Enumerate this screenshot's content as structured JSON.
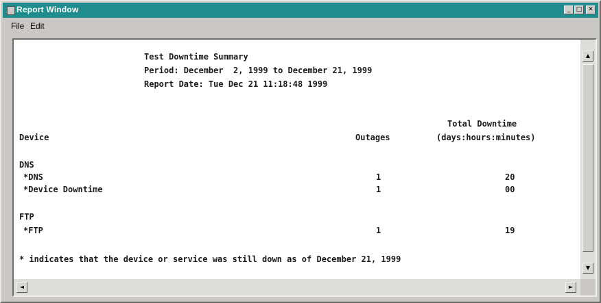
{
  "window": {
    "title": "Report Window",
    "minimize_glyph": "_",
    "maximize_glyph": "□",
    "close_glyph": "✕"
  },
  "menu": {
    "items": [
      {
        "label": "File"
      },
      {
        "label": "Edit"
      }
    ]
  },
  "report": {
    "title": "Test Downtime Summary",
    "period": "Period: December  2, 1999 to December 21, 1999",
    "report_date": "Report Date: Tue Dec 21 11:18:48 1999",
    "columns": {
      "device": "Device",
      "outages": "Outages",
      "total_downtime": "Total Downtime",
      "downtime_units": "(days:hours:minutes)"
    },
    "groups": [
      {
        "name": "DNS",
        "rows": [
          {
            "device": "*DNS",
            "outages": "1",
            "downtime": "20"
          },
          {
            "device": "*Device Downtime",
            "outages": "1",
            "downtime": "00"
          }
        ]
      },
      {
        "name": "FTP",
        "rows": [
          {
            "device": "*FTP",
            "outages": "1",
            "downtime": "19"
          }
        ]
      }
    ],
    "footnote": "* indicates that the device or service was still down as of December 21, 1999"
  },
  "scrollbars": {
    "up_glyph": "▲",
    "down_glyph": "▼",
    "left_glyph": "◄",
    "right_glyph": "►"
  },
  "colors": {
    "titlebar": "#1f8d8d",
    "window_face": "#c9c8c4",
    "content_background": "#ffffff"
  }
}
